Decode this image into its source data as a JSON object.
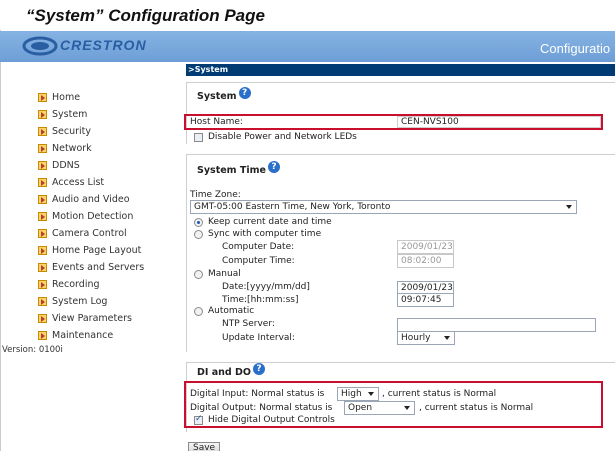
{
  "doc_title": "“System” Configuration Page",
  "banner": {
    "logo": "CRESTRON",
    "right_text": "Configuratio",
    "bg": "#7aa9dd",
    "accent": "#c8102e"
  },
  "breadcrumb": ">System",
  "nav": {
    "items": [
      "Home",
      "System",
      "Security",
      "Network",
      "DDNS",
      "Access List",
      "Audio and Video",
      "Motion Detection",
      "Camera Control",
      "Home Page Layout",
      "Events and Servers",
      "Recording",
      "System Log",
      "View Parameters",
      "Maintenance"
    ]
  },
  "version": "Version: 0100i",
  "system": {
    "title": "System",
    "host_label": "Host Name:",
    "host_value": "CEN-NVS100",
    "disable_leds_label": "Disable Power and Network LEDs"
  },
  "system_time": {
    "title": "System Time",
    "tz_label": "Time Zone:",
    "tz_value": "GMT-05:00 Eastern Time, New York, Toronto",
    "keep_label": "Keep current date and time",
    "sync_label": "Sync with computer time",
    "computer_date_label": "Computer Date:",
    "computer_date_value": "2009/01/23",
    "computer_time_label": "Computer Time:",
    "computer_time_value": "08:02:00",
    "manual_label": "Manual",
    "date_label": "Date:[yyyy/mm/dd]",
    "date_value": "2009/01/23",
    "time_label": "Time:[hh:mm:ss]",
    "time_value": "09:07:45",
    "automatic_label": "Automatic",
    "ntp_label": "NTP Server:",
    "ntp_value": "",
    "interval_label": "Update Interval:",
    "interval_value": "Hourly"
  },
  "dido": {
    "title": "DI and DO",
    "di_prefix": "Digital Input: Normal status is",
    "di_value": "High",
    "di_suffix": ", current status is Normal",
    "do_prefix": "Digital Output: Normal status is",
    "do_value": "Open",
    "do_suffix": ", current status is Normal",
    "hide_label": "Hide Digital Output Controls"
  },
  "save_label": "Save"
}
